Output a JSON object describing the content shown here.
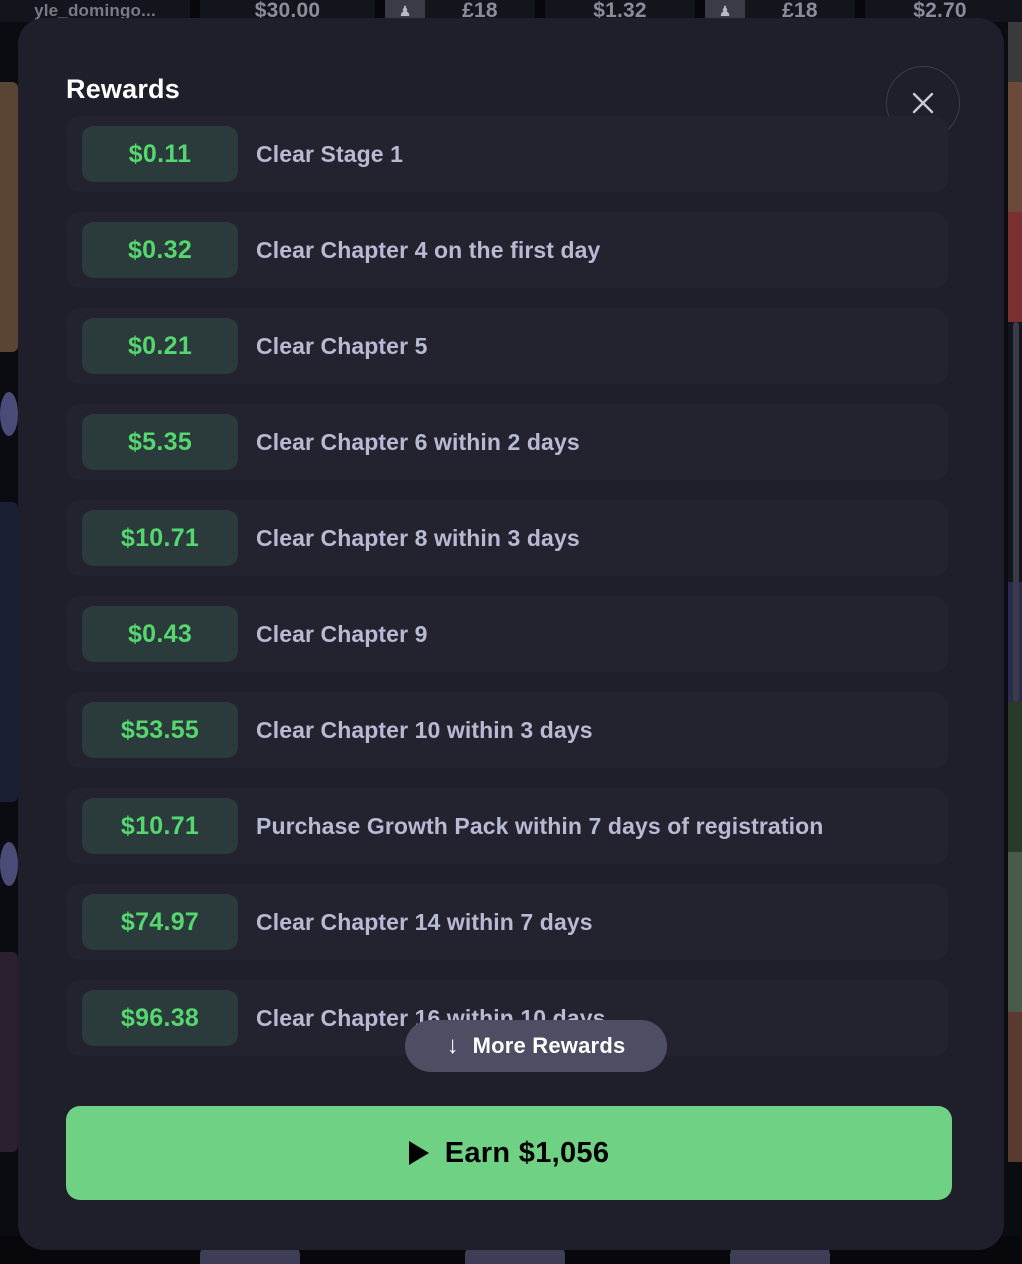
{
  "background": {
    "top_row": [
      {
        "type": "name",
        "text": "yle_domingo..."
      },
      {
        "type": "price",
        "text": "$30.00"
      },
      {
        "type": "thumb",
        "text": "♟"
      },
      {
        "type": "price_alt",
        "text": "£18"
      },
      {
        "type": "price",
        "text": "$1.32"
      },
      {
        "type": "thumb",
        "text": "♟"
      },
      {
        "type": "price_alt",
        "text": "£18"
      },
      {
        "type": "price",
        "text": "$2.70"
      }
    ],
    "scrollbar_visible": true
  },
  "modal": {
    "title": "Rewards",
    "close_icon": "close-icon",
    "rewards": [
      {
        "amount": "$0.11",
        "task": "Clear Stage 1"
      },
      {
        "amount": "$0.32",
        "task": "Clear Chapter 4 on the first day"
      },
      {
        "amount": "$0.21",
        "task": "Clear Chapter 5"
      },
      {
        "amount": "$5.35",
        "task": "Clear Chapter 6 within 2 days"
      },
      {
        "amount": "$10.71",
        "task": "Clear Chapter 8 within 3 days"
      },
      {
        "amount": "$0.43",
        "task": "Clear Chapter 9"
      },
      {
        "amount": "$53.55",
        "task": "Clear Chapter 10 within 3 days"
      },
      {
        "amount": "$10.71",
        "task": "Purchase Growth Pack within 7 days of registration"
      },
      {
        "amount": "$74.97",
        "task": "Clear Chapter 14 within 7 days"
      },
      {
        "amount": "$96.38",
        "task": "Clear Chapter 16 within 10 days"
      }
    ],
    "more_rewards": {
      "label": "More Rewards",
      "arrow_icon": "arrow-down-icon"
    },
    "earn_button": {
      "label": "Earn $1,056",
      "play_icon": "play-icon"
    },
    "colors": {
      "accent_green": "#6fd184",
      "amount_green": "#56d66f",
      "modal_bg": "#1f1f2b",
      "row_bg": "#232330",
      "badge_bg": "#2b3a3a",
      "label_text": "#b8bad4",
      "pill_bg": "#4d4d64"
    }
  }
}
